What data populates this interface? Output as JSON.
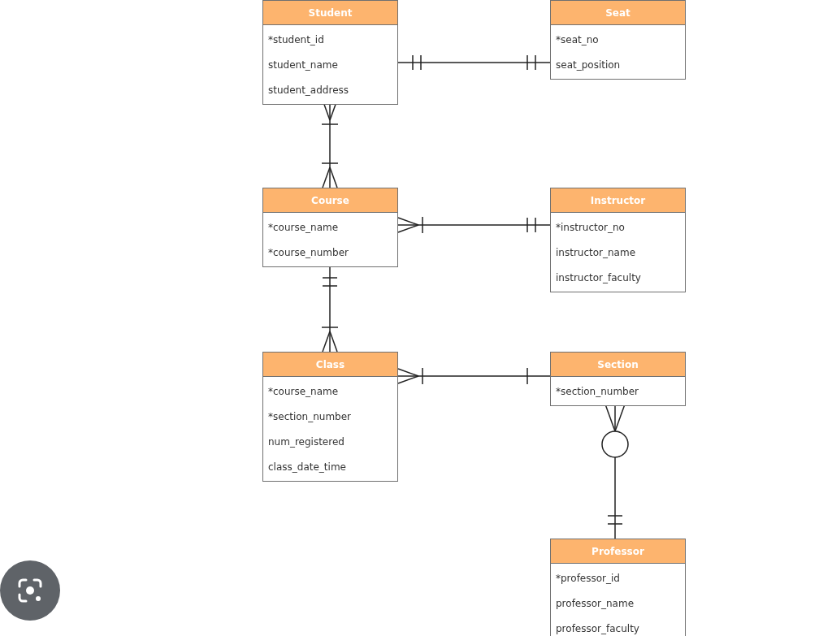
{
  "entities": [
    {
      "name": "Student",
      "attributes": [
        "*student_id",
        "student_name",
        "student_address"
      ]
    },
    {
      "name": "Seat",
      "attributes": [
        "*seat_no",
        "seat_position"
      ]
    },
    {
      "name": "Course",
      "attributes": [
        "*course_name",
        "*course_number"
      ]
    },
    {
      "name": "Instructor",
      "attributes": [
        "*instructor_no",
        "instructor_name",
        "instructor_faculty"
      ]
    },
    {
      "name": "Class",
      "attributes": [
        "*course_name",
        "*section_number",
        "num_registered",
        "class_date_time"
      ]
    },
    {
      "name": "Section",
      "attributes": [
        "*section_number"
      ]
    },
    {
      "name": "Professor",
      "attributes": [
        "*professor_id",
        "professor_name",
        "professor_faculty"
      ]
    }
  ],
  "relationships": [
    {
      "ends": [
        {
          "kind": "one_only"
        },
        {
          "kind": "one_only"
        }
      ]
    },
    {
      "ends": [
        {
          "kind": "one_or_many"
        },
        {
          "kind": "one_or_many"
        }
      ]
    },
    {
      "ends": [
        {
          "kind": "one_or_many"
        },
        {
          "kind": "one_only"
        }
      ]
    },
    {
      "ends": [
        {
          "kind": "one_only"
        },
        {
          "kind": "one_or_many"
        }
      ]
    },
    {
      "ends": [
        {
          "kind": "one_or_many"
        },
        {
          "kind": "one"
        }
      ]
    },
    {
      "ends": [
        {
          "kind": "zero_or_many"
        },
        {
          "kind": "one_only"
        }
      ]
    }
  ]
}
